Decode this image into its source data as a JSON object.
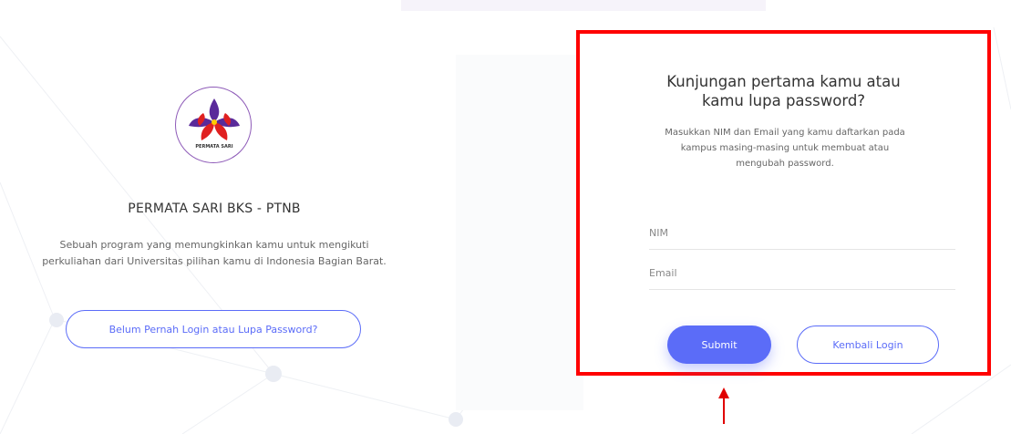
{
  "brand": {
    "logo_text": "PERMATA SARI",
    "title": "PERMATA SARI BKS - PTNB",
    "description_line1": "Sebuah program yang memungkinkan kamu untuk mengikuti",
    "description_line2": "perkuliahan dari Universitas pilihan kamu di Indonesia Bagian Barat.",
    "first_login_button": "Belum Pernah Login atau Lupa Password?"
  },
  "form": {
    "title_line1": "Kunjungan pertama kamu atau",
    "title_line2": "kamu lupa password?",
    "subtitle_line1": "Masukkan NIM dan Email yang kamu daftarkan pada",
    "subtitle_line2": "kampus masing-masing untuk membuat atau",
    "subtitle_line3": "mengubah password.",
    "nim_placeholder": "NIM",
    "email_placeholder": "Email",
    "submit_label": "Submit",
    "back_label": "Kembali Login"
  },
  "colors": {
    "accent": "#5b6cf8",
    "highlight_border": "#ff0000",
    "logo_red": "#e02020",
    "logo_purple": "#5a2a9a"
  }
}
